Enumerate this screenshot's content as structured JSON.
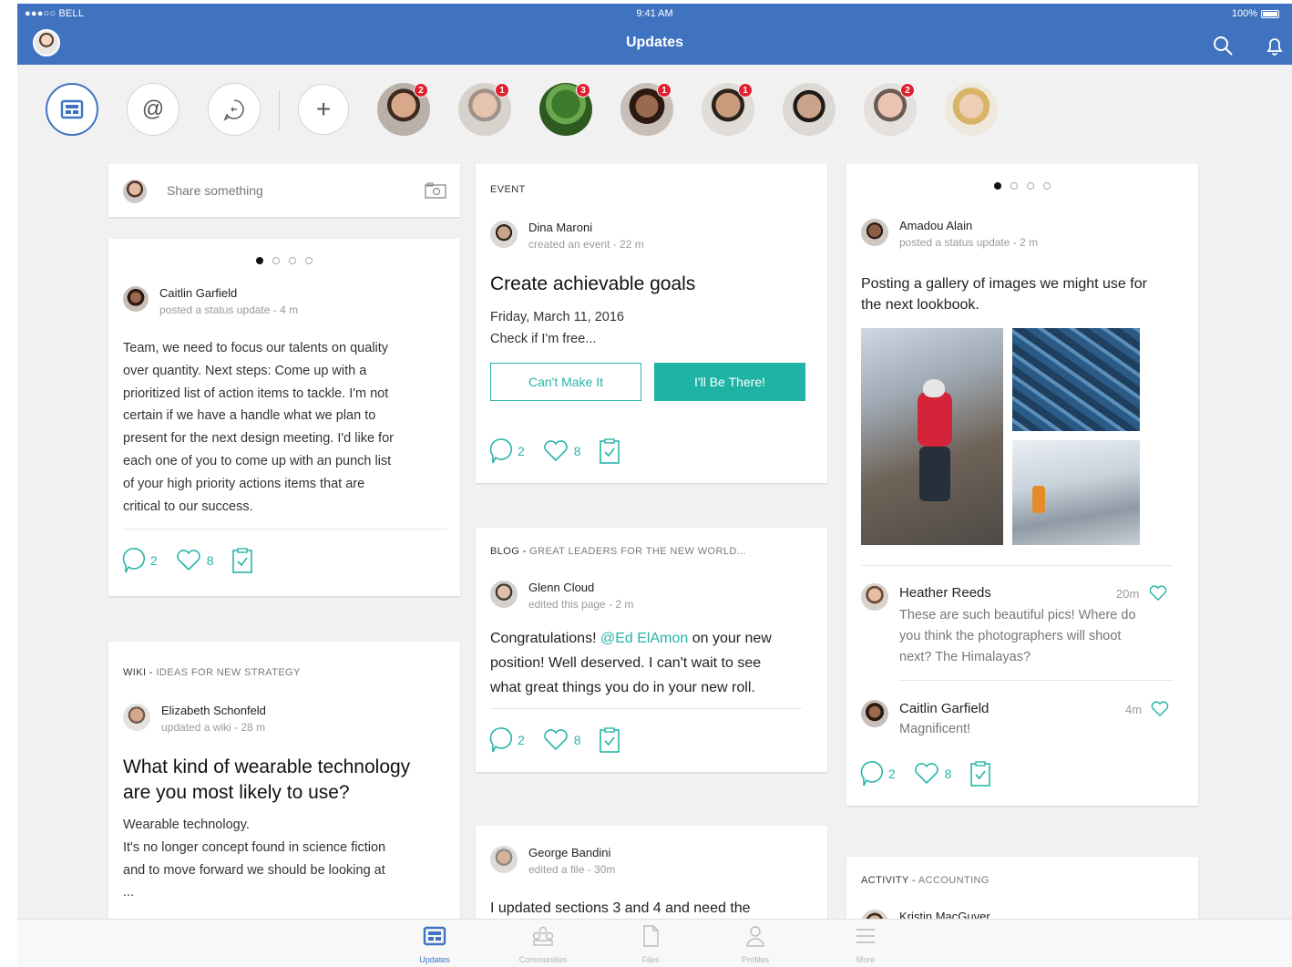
{
  "status_bar": {
    "carrier": "●●●○○ BELL",
    "time": "9:41 AM",
    "battery": "100%"
  },
  "header": {
    "title": "Updates",
    "icons": [
      "search-icon",
      "bell-icon"
    ]
  },
  "filters": {
    "icons": [
      "updates-icon",
      "at-mention-icon",
      "chat-icon",
      "add-icon"
    ]
  },
  "people": [
    {
      "badge": "2"
    },
    {
      "badge": "1"
    },
    {
      "badge": "3"
    },
    {
      "badge": "1"
    },
    {
      "badge": "1"
    },
    {
      "badge": ""
    },
    {
      "badge": "2"
    },
    {
      "badge": ""
    }
  ],
  "share": {
    "placeholder": "Share something"
  },
  "card_caitlin": {
    "name": "Caitlin Garfield",
    "meta": "posted a status update - 4 m",
    "lines": [
      "Team, we need to focus our talents  on quality",
      "over quantity. Next steps: Come up with a",
      "prioritized list of action items to tackle. I'm not",
      "certain if we have a handle what we plan to",
      "present for the next design meeting. I'd like for",
      "each one of you to come up with an punch list",
      "of your high priority actions items that are",
      "critical to our success."
    ],
    "comments": "2",
    "likes": "8"
  },
  "card_wiki": {
    "type": "WIKI -",
    "subtitle": "IDEAS FOR NEW STRATEGY",
    "name": "Elizabeth Schonfeld",
    "meta": "updated a wiki - 28 m",
    "title_l1": "What kind of wearable technology",
    "title_l2": "are you most likely to use?",
    "text_l1": "Wearable technology.",
    "text_l2": "It's no longer concept found in science fiction",
    "text_l3": "and to move forward we should be looking at",
    "ellipsis": "..."
  },
  "card_event": {
    "type": "EVENT",
    "name": "Dina Maroni",
    "meta": "created an event - 22 m",
    "title": "Create achievable goals",
    "date": "Friday, March 11, 2016",
    "check": "Check if I'm free...",
    "decline": "Can't Make It",
    "accept": "I'll Be There!",
    "comments": "2",
    "likes": "8"
  },
  "card_blog": {
    "type": "BLOG -",
    "subtitle": "GREAT LEADERS FOR THE NEW WORLD...",
    "name": "Glenn Cloud",
    "meta": "edited this page - 2 m",
    "l1_a": "Congratulations! ",
    "l1_mention": "@Ed ElAmon",
    "l1_b": " on your new",
    "l2": "position! Well deserved. I can't wait to see",
    "l3": "what great things you do in your new roll.",
    "comments": "2",
    "likes": "8"
  },
  "card_file": {
    "name": "George Bandini",
    "meta": "edited a file - 30m",
    "text": "I updated sections 3 and 4 and need the"
  },
  "card_gallery": {
    "name": "Amadou Alain",
    "meta": "posted a status update - 2 m",
    "text_l1": "Posting a gallery of images we might use for",
    "text_l2": "the next lookbook.",
    "comment1": {
      "name": "Heather Reeds",
      "time": "20m",
      "l1": "These are such beautiful pics! Where do",
      "l2": "you think the photographers will shoot",
      "l3": "next? The Himalayas?"
    },
    "comment2": {
      "name": "Caitlin Garfield",
      "time": "4m",
      "text": "Magnificent!"
    },
    "comments": "2",
    "likes": "8"
  },
  "card_activity": {
    "type": "ACTIVITY -",
    "subtitle": "ACCOUNTING",
    "name": "Kristin MacGuver"
  },
  "tabs": [
    {
      "label": "Updates",
      "icon": "updates-icon",
      "active": true
    },
    {
      "label": "Communities",
      "icon": "communities-icon",
      "active": false
    },
    {
      "label": "Files",
      "icon": "file-icon",
      "active": false
    },
    {
      "label": "Profiles",
      "icon": "profile-icon",
      "active": false
    },
    {
      "label": "More",
      "icon": "menu-icon",
      "active": false
    }
  ],
  "colors": {
    "brand": "#3f73c0",
    "accent": "#27b5a8",
    "badge": "#e0202e"
  }
}
